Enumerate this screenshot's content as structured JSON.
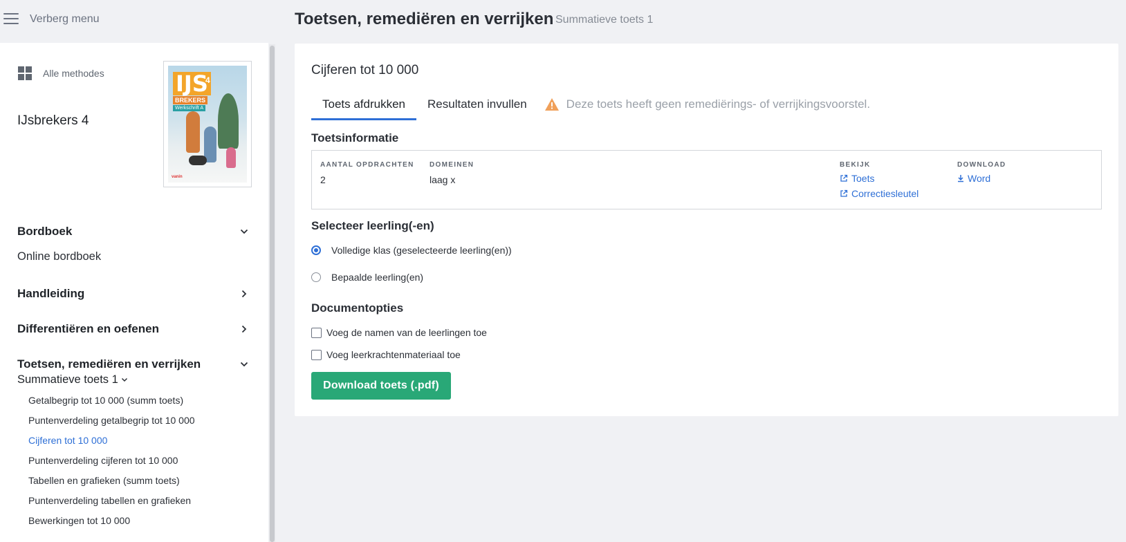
{
  "header": {
    "hide_menu": "Verberg menu",
    "title": "Toetsen, remediëren en verrijken",
    "subtitle": "Summatieve toets 1"
  },
  "sidebar": {
    "all_methods": "Alle methodes",
    "book_title": "IJsbrekers 4",
    "cover": {
      "brand": "IJS",
      "number": "4",
      "brekers": "BREKERS",
      "werkschrift": "Werkschrift A",
      "publisher": "vanin"
    },
    "sections": {
      "bordboek": "Bordboek",
      "online_bordboek": "Online bordboek",
      "handleiding": "Handleiding",
      "differentieren": "Differentiëren en oefenen",
      "toetsen": "Toetsen, remediëren en verrijken"
    },
    "subgroup": "Summatieve toets 1",
    "items": [
      "Getalbegrip tot 10 000 (summ toets)",
      "Puntenverdeling getalbegrip tot 10 000",
      "Cijferen tot 10 000",
      "Puntenverdeling cijferen tot 10 000",
      "Tabellen en grafieken (summ toets)",
      "Puntenverdeling tabellen en grafieken",
      "Bewerkingen tot 10 000"
    ],
    "active_item": "Cijferen tot 10 000"
  },
  "main": {
    "title": "Cijferen tot 10 000",
    "tabs": [
      "Toets afdrukken",
      "Resultaten invullen"
    ],
    "notice": "Deze toets heeft geen remediërings- of verrijkingsvoorstel.",
    "info_title": "Toetsinformatie",
    "info": {
      "count_head": "AANTAL OPDRACHTEN",
      "count_val": "2",
      "domains_head": "DOMEINEN",
      "domains_val": "laag x",
      "view_head": "BEKIJK",
      "view_links": [
        "Toets",
        "Correctiesleutel"
      ],
      "download_head": "DOWNLOAD",
      "download_link": "Word"
    },
    "select_title": "Selecteer leerling(-en)",
    "radios": [
      "Volledige klas (geselecteerde leerling(en))",
      "Bepaalde leerling(en)"
    ],
    "doc_title": "Documentopties",
    "checkboxes": [
      "Voeg de namen van de leerlingen toe",
      "Voeg leerkrachtenmateriaal toe"
    ],
    "download_button": "Download toets (.pdf)"
  },
  "colors": {
    "accent_blue": "#2e6fd6",
    "button_green": "#29a877",
    "warning_orange": "#f0a05a"
  }
}
